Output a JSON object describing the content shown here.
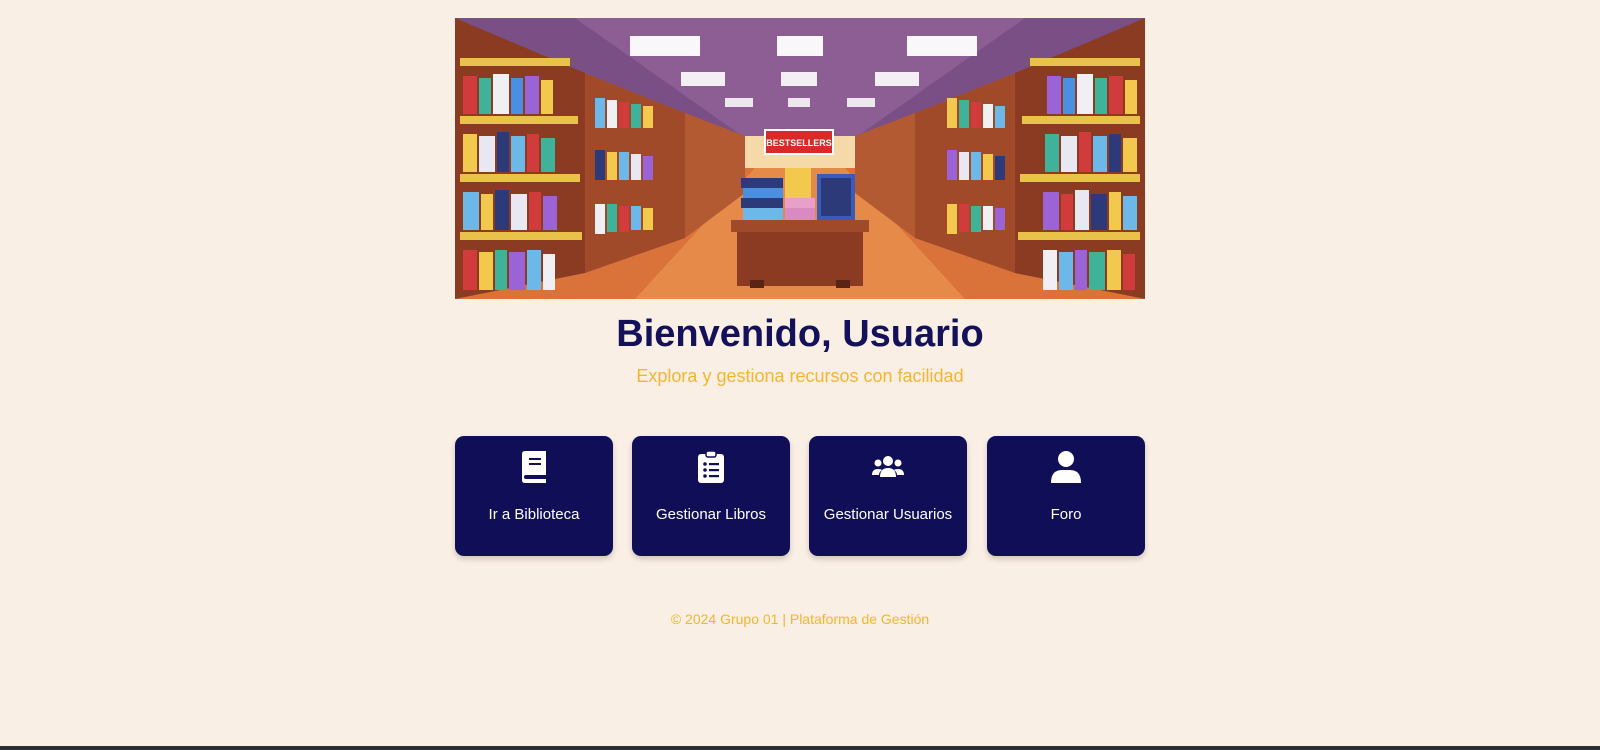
{
  "banner": {
    "sign_text": "BESTSELLERS"
  },
  "header": {
    "title": "Bienvenido, Usuario",
    "subtitle": "Explora y gestiona recursos con facilidad"
  },
  "cards": [
    {
      "label": "Ir a Biblioteca",
      "icon": "book-icon"
    },
    {
      "label": "Gestionar Libros",
      "icon": "clipboard-list-icon"
    },
    {
      "label": "Gestionar Usuarios",
      "icon": "users-icon"
    },
    {
      "label": "Foro",
      "icon": "user-icon"
    }
  ],
  "footer": {
    "text": "© 2024 Grupo 01 | Plataforma de Gestión"
  },
  "colors": {
    "background": "#faefe4",
    "primary": "#110e58",
    "accent": "#f3b62e"
  }
}
